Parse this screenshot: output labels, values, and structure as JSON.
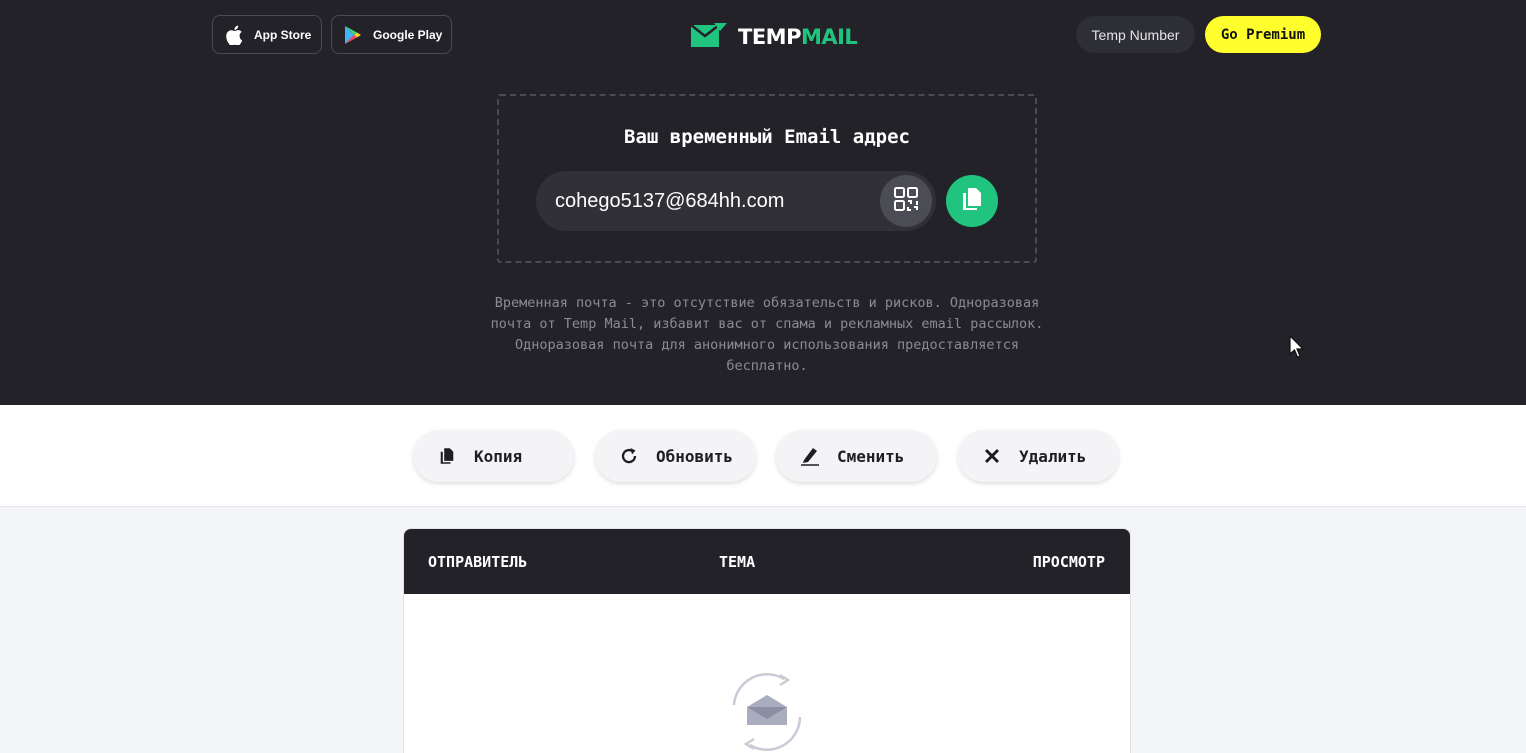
{
  "header": {
    "app_store": "App Store",
    "google_play": "Google Play",
    "logo_temp": "TEMP",
    "logo_mail": "MAIL",
    "temp_number": "Temp Number",
    "go_premium": "Go Premium"
  },
  "email_card": {
    "title": "Ваш временный Email адрес",
    "address": "cohego5137@684hh.com"
  },
  "description": "Временная почта - это отсутствие обязательств и рисков. Одноразовая почта от Temp Mail, избавит вас от спама и рекламных email рассылок. Одноразовая почта для анонимного использования предоставляется бесплатно.",
  "actions": {
    "copy": "Копия",
    "refresh": "Обновить",
    "change": "Сменить",
    "delete": "Удалить"
  },
  "inbox": {
    "columns": {
      "sender": "ОТПРАВИТЕЛЬ",
      "subject": "ТЕМА",
      "view": "ПРОСМОТР"
    }
  },
  "icons": [
    "apple-icon",
    "google-play-icon",
    "mail-logo-icon",
    "qr-code-icon",
    "copy-icon",
    "refresh-icon",
    "edit-icon",
    "close-icon",
    "empty-inbox-icon"
  ],
  "colors": {
    "hero_bg": "#222228",
    "accent_green": "#21c47e",
    "premium_yellow": "#ffff2e"
  }
}
